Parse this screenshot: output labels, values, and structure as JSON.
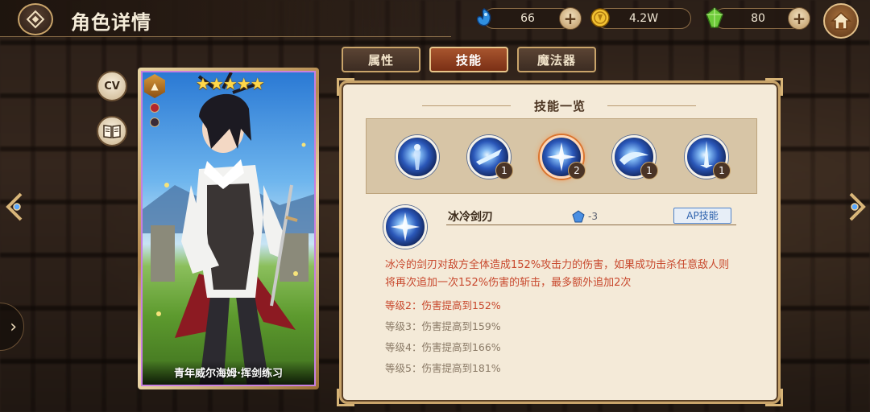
{
  "header": {
    "title": "角色详情"
  },
  "currencies": [
    {
      "name": "blue-crystal",
      "value": "66"
    },
    {
      "name": "gold-coin",
      "value": "4.2W"
    },
    {
      "name": "green-gem",
      "value": "80"
    }
  ],
  "side_buttons": {
    "cv_label": "CV"
  },
  "card": {
    "stars": "★★★★★",
    "caption": "青年威尔海姆·挥剑练习"
  },
  "tabs": [
    {
      "label": "属性",
      "active": false
    },
    {
      "label": "技能",
      "active": true
    },
    {
      "label": "魔法器",
      "active": false
    }
  ],
  "skills_panel": {
    "title": "技能一览",
    "skills": [
      {
        "icon": "character-skill-icon",
        "level": ""
      },
      {
        "icon": "ice-slash-skill-icon",
        "level": "1"
      },
      {
        "icon": "ice-blade-skill-icon",
        "level": "2"
      },
      {
        "icon": "ice-wave-skill-icon",
        "level": "1"
      },
      {
        "icon": "ice-sword-skill-icon",
        "level": "1"
      }
    ],
    "selected_index": 2,
    "detail": {
      "name": "冰冷剑刃",
      "ap_cost": "-3",
      "type_badge": "AP技能",
      "description": "冰冷的剑刃对敌方全体造成152%攻击力的伤害，如果成功击杀任意敌人则将再次追加一次152%伤害的斩击，最多额外追加2次",
      "levels": [
        {
          "text": "等级2：伤害提高到152%",
          "active": true
        },
        {
          "text": "等级3：伤害提高到159%",
          "active": false
        },
        {
          "text": "等级4：伤害提高到166%",
          "active": false
        },
        {
          "text": "等级5：伤害提高到181%",
          "active": false
        }
      ]
    }
  },
  "colors": {
    "accent_gold": "#c9a46a",
    "active_tab": "#a8552e",
    "description_red": "#c8482d",
    "ap_blue": "#2e62ad"
  }
}
